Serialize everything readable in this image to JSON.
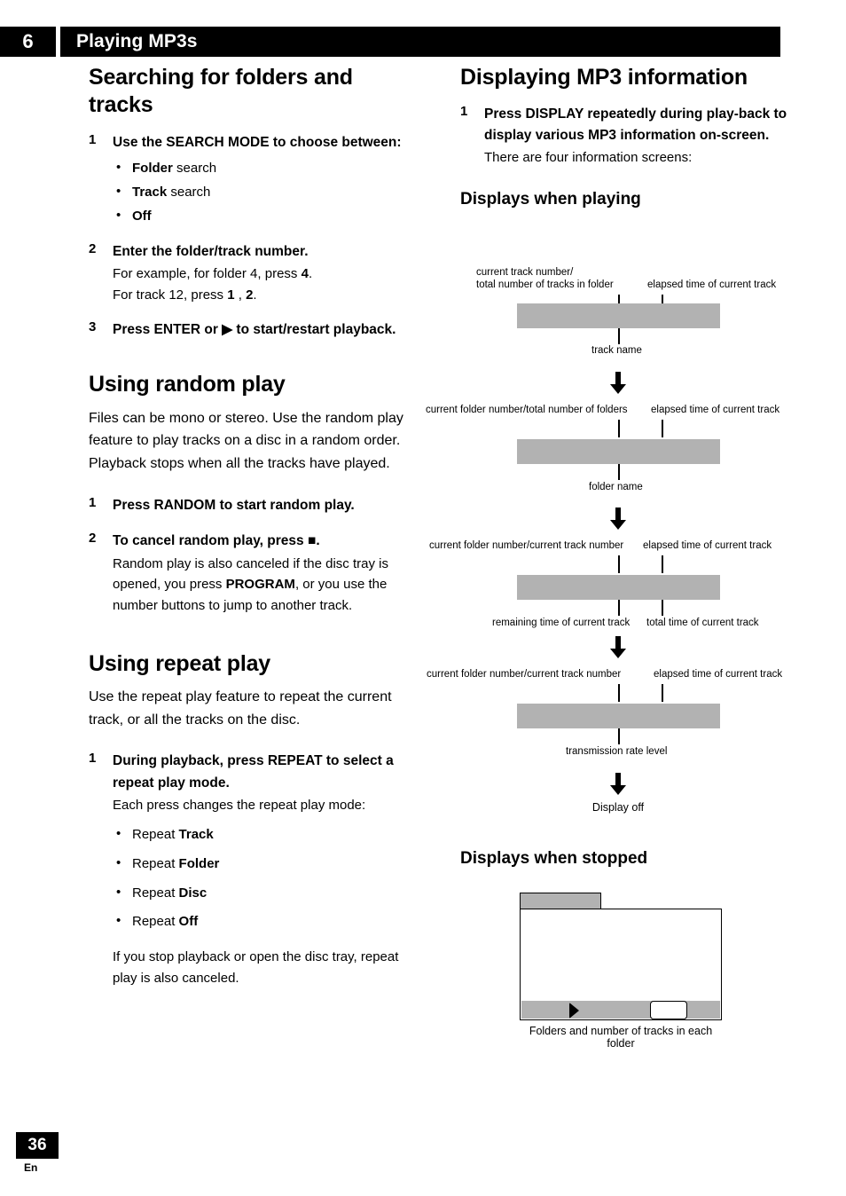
{
  "header": {
    "chapter_number": "6",
    "chapter_title": "Playing MP3s"
  },
  "left_column": {
    "section1_heading": "Searching for folders and tracks",
    "s1_step1_num": "1",
    "s1_step1_lead": "Use the SEARCH MODE to choose between:",
    "s1_step1_bullets": [
      {
        "bold": "Folder",
        "rest": " search"
      },
      {
        "bold": "Track",
        "rest": " search"
      },
      {
        "bold": "Off",
        "rest": ""
      }
    ],
    "s1_step2_num": "2",
    "s1_step2_lead": "Enter the folder/track number.",
    "s1_step2_line1_a": "For example, for folder 4, press ",
    "s1_step2_line1_b": "4",
    "s1_step2_line1_c": ".",
    "s1_step2_line2_a": "For track 12, press ",
    "s1_step2_line2_b": "1",
    "s1_step2_line2_c": " , ",
    "s1_step2_line2_d": "2",
    "s1_step2_line2_e": ".",
    "s1_step3_num": "3",
    "s1_step3_lead_a": "Press ENTER or ",
    "s1_step3_play_icon": "▶",
    "s1_step3_lead_b": " to start/restart playback.",
    "section2_heading": "Using random play",
    "section2_intro": "Files can be mono or stereo. Use the random play feature to play tracks on a disc in a random order. Playback stops when all the tracks have played.",
    "s2_step1_num": "1",
    "s2_step1_lead": "Press RANDOM to start random play.",
    "s2_step2_num": "2",
    "s2_step2_lead_a": "To cancel random play, press ",
    "s2_step2_stop_icon": "■",
    "s2_step2_lead_b": ".",
    "s2_step2_body_a": "Random play is also canceled if the disc tray is opened, you press ",
    "s2_step2_body_b": "PROGRAM",
    "s2_step2_body_c": ", or you use the number buttons to jump to another track.",
    "section3_heading": "Using repeat play",
    "section3_intro": "Use the repeat play feature to repeat the current track, or all the tracks on the disc.",
    "s3_step1_num": "1",
    "s3_step1_lead": "During playback, press REPEAT to select a repeat play mode.",
    "s3_step1_body": "Each press changes the repeat play mode:",
    "s3_bullets": [
      {
        "plain": "Repeat ",
        "bold": "Track"
      },
      {
        "plain": "Repeat ",
        "bold": "Folder"
      },
      {
        "plain": "Repeat ",
        "bold": "Disc"
      },
      {
        "plain": "Repeat ",
        "bold": "Off"
      }
    ],
    "s3_closing": "If you stop playback or open the disc tray, repeat play is also canceled."
  },
  "right_column": {
    "section_heading": "Displaying MP3 information",
    "step1_num": "1",
    "step1_lead": "Press DISPLAY repeatedly during play-back to display various MP3 information on-screen.",
    "step1_body": "There are four information screens:",
    "sub_playing_heading": "Displays when playing",
    "sub_stopped_heading": "Displays when stopped",
    "display_off_label": "Display off",
    "stopped_caption": "Folders and number of tracks in each folder",
    "diagrams": [
      {
        "top_left_label": "current track number/\ntotal number of tracks in folder",
        "top_right_label": "elapsed time of current track",
        "bottom_left_label": "track name",
        "bottom_right_label": ""
      },
      {
        "top_left_label": "current folder number/total number of folders",
        "top_right_label": "elapsed time of current track",
        "bottom_left_label": "folder name",
        "bottom_right_label": ""
      },
      {
        "top_left_label": "current folder number/current track number",
        "top_right_label": "elapsed time of current track",
        "bottom_left_label": "remaining time of current track",
        "bottom_right_label": "total time of current track"
      },
      {
        "top_left_label": "current folder number/current track number",
        "top_right_label": "elapsed time of current track",
        "bottom_left_label": "transmission rate level",
        "bottom_right_label": ""
      }
    ]
  },
  "footer": {
    "page_number": "36",
    "language": "En"
  },
  "colors": {
    "bar_gray": "#b2b2b2",
    "ink": "#000000",
    "paper": "#ffffff"
  }
}
